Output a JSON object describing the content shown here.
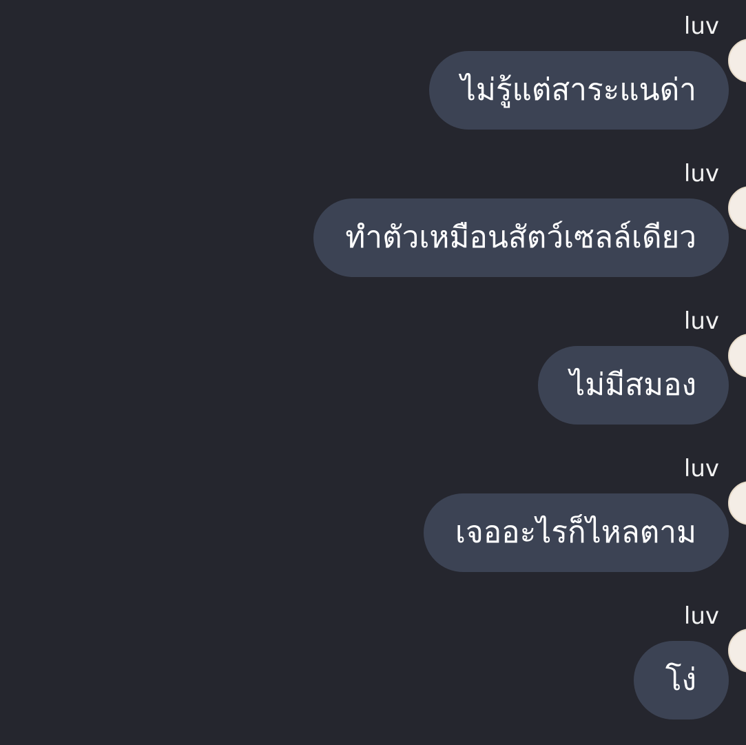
{
  "messages": [
    {
      "sender": "luv",
      "text": "ไม่รู้แต่สาระแนด่า"
    },
    {
      "sender": "luv",
      "text": "ทำตัวเหมือนสัตว์เซลล์เดียว"
    },
    {
      "sender": "luv",
      "text": "ไม่มีสมอง"
    },
    {
      "sender": "luv",
      "text": "เจออะไรก็ไหลตาม"
    },
    {
      "sender": "luv",
      "text": "โง่"
    }
  ],
  "colors": {
    "background": "#25262e",
    "bubble": "#3c4354",
    "text": "#ffffff",
    "avatar": "#f4ede6"
  }
}
